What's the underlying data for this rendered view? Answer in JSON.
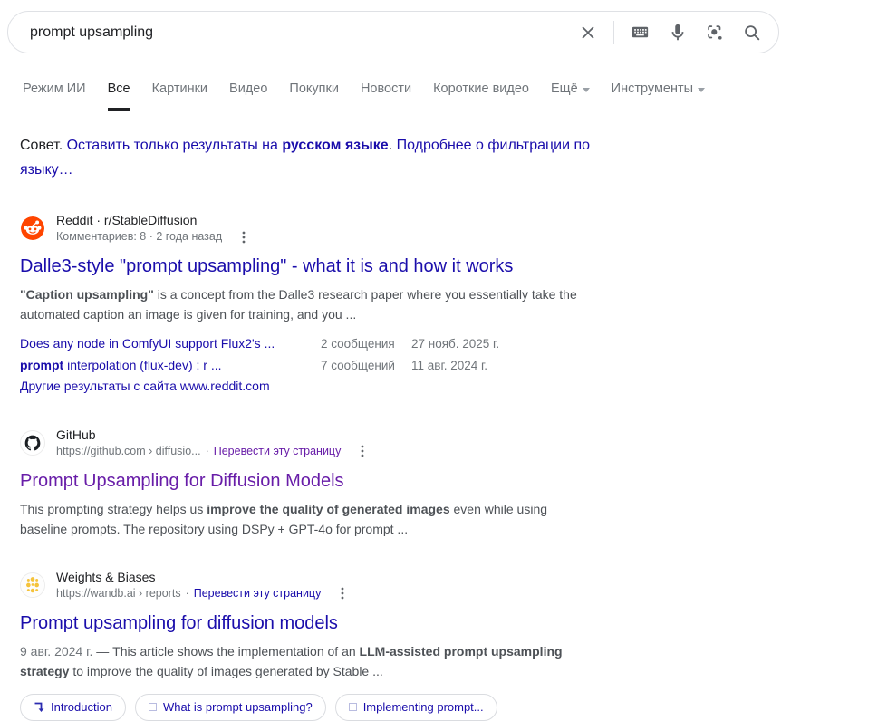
{
  "theme": {
    "link_blue": "#1a0dab",
    "visited_purple": "#681da8",
    "text_dark": "#202124",
    "snippet_gray": "#4d5156",
    "meta_gray": "#70757a",
    "icon_gray": "#5f6368",
    "reddit_orange": "#ff4500",
    "wandb_yellow": "#f5c33b",
    "border_gray": "#dfe1e5"
  },
  "search": {
    "query": "prompt upsampling",
    "icons": [
      "clear-icon",
      "keyboard-icon",
      "mic-icon",
      "lens-icon",
      "search-icon"
    ]
  },
  "tabs": {
    "items": [
      {
        "label": "Режим ИИ",
        "active": false,
        "dropdown": false
      },
      {
        "label": "Все",
        "active": true,
        "dropdown": false
      },
      {
        "label": "Картинки",
        "active": false,
        "dropdown": false
      },
      {
        "label": "Видео",
        "active": false,
        "dropdown": false
      },
      {
        "label": "Покупки",
        "active": false,
        "dropdown": false
      },
      {
        "label": "Новости",
        "active": false,
        "dropdown": false
      },
      {
        "label": "Короткие видео",
        "active": false,
        "dropdown": false
      },
      {
        "label": "Ещё",
        "active": false,
        "dropdown": true
      },
      {
        "label": "Инструменты",
        "active": false,
        "dropdown": true
      }
    ]
  },
  "tip": {
    "prefix": "Совет. ",
    "link1_normal": "Оставить только результаты на ",
    "link1_bold": "русском языке",
    "separator": ". ",
    "link2": "Подробнее о фильтрации по языку…"
  },
  "results": [
    {
      "source": "Reddit · r/StableDiffusion",
      "meta": "Комментариев: 8 · 2 года назад",
      "title": "Dalle3-style \"prompt upsampling\" - what it is and how it works",
      "snippet_pre": "",
      "snippet_bold": "\"Caption upsampling\"",
      "snippet_post": " is a concept from the Dalle3 research paper where you essentially take the automated caption an image is given for training, and you ...",
      "sublinks": [
        {
          "pre": "Does any node in ComfyUI support Flux2's ...",
          "bold": "",
          "post": "",
          "count": "2 сообщения",
          "date": "27 нояб. 2025 г."
        },
        {
          "pre": "",
          "bold": "prompt",
          "post": " interpolation (flux-dev) : r ...",
          "count": "7 сообщений",
          "date": "11 авг. 2024 г."
        },
        {
          "pre": "Другие результаты с сайта www.reddit.com",
          "bold": "",
          "post": "",
          "count": "",
          "date": ""
        }
      ]
    },
    {
      "source": "GitHub",
      "breadcrumb": "https://github.com › diffusio...",
      "translate_sep": "·",
      "translate": "Перевести эту страницу",
      "title": "Prompt Upsampling for Diffusion Models",
      "snippet_pre": "This prompting strategy helps us ",
      "snippet_bold": "improve the quality of generated images",
      "snippet_post": " even while using baseline prompts. The repository using DSPy + GPT-4o for prompt ..."
    },
    {
      "source": "Weights & Biases",
      "breadcrumb": "https://wandb.ai › reports",
      "translate_sep": "·",
      "translate": "Перевести эту страницу",
      "title": "Prompt upsampling for diffusion models",
      "snippet_date": "9 авг. 2024 г.",
      "snippet_pre": " — This article shows the implementation of an ",
      "snippet_bold": "LLM-assisted prompt upsampling strategy",
      "snippet_post": " to improve the quality of images generated by Stable ..."
    }
  ],
  "chips": [
    {
      "label": "Introduction"
    },
    {
      "label": "What is prompt upsampling?"
    },
    {
      "label": "Implementing prompt..."
    }
  ]
}
